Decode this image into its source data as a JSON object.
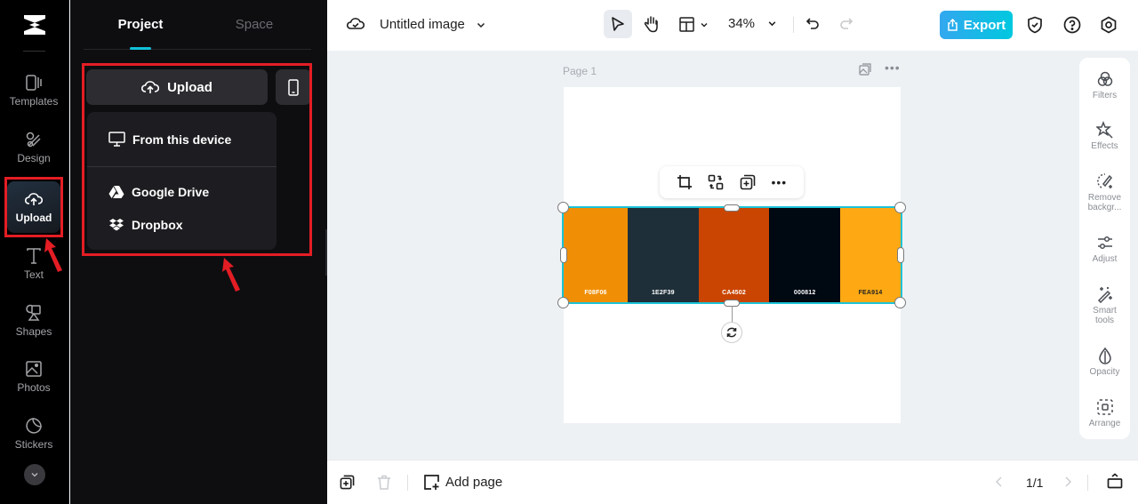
{
  "rail": {
    "items": [
      {
        "label": "Templates",
        "icon": "templates-icon"
      },
      {
        "label": "Design",
        "icon": "design-icon"
      },
      {
        "label": "Upload",
        "icon": "upload-cloud-icon",
        "active": true
      },
      {
        "label": "Text",
        "icon": "text-icon"
      },
      {
        "label": "Shapes",
        "icon": "shapes-icon"
      },
      {
        "label": "Photos",
        "icon": "photos-icon"
      },
      {
        "label": "Stickers",
        "icon": "stickers-icon"
      }
    ]
  },
  "panel": {
    "tabs": [
      {
        "label": "Project",
        "active": true
      },
      {
        "label": "Space",
        "active": false
      }
    ],
    "upload_label": "Upload",
    "menu": [
      {
        "label": "From this device",
        "icon": "monitor-icon"
      },
      {
        "label": "Google Drive",
        "icon": "google-drive-icon"
      },
      {
        "label": "Dropbox",
        "icon": "dropbox-icon"
      }
    ]
  },
  "topbar": {
    "title": "Untitled image",
    "zoom": "34%",
    "export_label": "Export"
  },
  "canvas": {
    "page_label": "Page 1",
    "palette": [
      {
        "code": "F08F06",
        "color": "#F08F06"
      },
      {
        "code": "1E2F39",
        "color": "#1E2F39"
      },
      {
        "code": "CA4502",
        "color": "#CA4502"
      },
      {
        "code": "000812",
        "color": "#000812"
      },
      {
        "code": "FEA914",
        "color": "#FEA914"
      }
    ]
  },
  "right_tools": [
    {
      "label": "Filters"
    },
    {
      "label": "Effects"
    },
    {
      "label": "Remove backgr..."
    },
    {
      "label": "Adjust"
    },
    {
      "label": "Smart tools"
    },
    {
      "label": "Opacity"
    },
    {
      "label": "Arrange"
    }
  ],
  "bottombar": {
    "add_page": "Add page",
    "page_indicator": "1/1"
  },
  "colors": {
    "accent": "#11C1D9",
    "annotation": "#E41D24"
  }
}
